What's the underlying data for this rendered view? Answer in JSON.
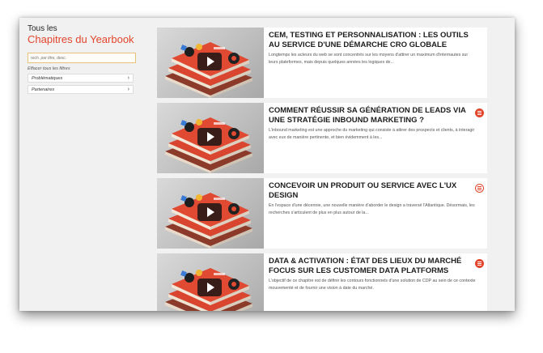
{
  "sidebar": {
    "title_top": "Tous les",
    "title_main": "Chapitres du Yearbook",
    "search_placeholder": "rech. par titre, desc.",
    "clear_filters": "Effacer tous les filtres",
    "filters": [
      {
        "label": "Problématiques"
      },
      {
        "label": "Partenaires"
      }
    ]
  },
  "cards": [
    {
      "title": "CEM, TESTING ET PERSONNALISATION : LES OUTILS AU SERVICE D'UNE DÉMARCHE CRO GLOBALE",
      "description": "Longtemps les acteurs du web se sont concentrés sur les moyens d'attirer un maximum d'internautes sur leurs plateformes, mais depuis quelques années les logiques de...",
      "icon": "none"
    },
    {
      "title": "COMMENT RÉUSSIR SA GÉNÉRATION DE LEADS VIA UNE STRATÉGIE INBOUND MARKETING ?",
      "description": "L'inbound marketing est une approche du marketing qui consiste à attirer des prospects et clients, à interagir avec eux de manière pertinente, et bien évidemment à les...",
      "icon": "filled"
    },
    {
      "title": "CONCEVOIR UN PRODUIT OU SERVICE AVEC L'UX DESIGN",
      "description": "En l'espace d'une décennie, une nouvelle manière d'aborder le design a traversé l'Atlantique. Désormais, les recherches s'articulent de plus en plus autour de la...",
      "icon": "outline"
    },
    {
      "title": "DATA & ACTIVATION : ÉTAT DES LIEUX DU MARCHÉ FOCUS SUR LES CUSTOMER DATA PLATFORMS",
      "description": "L'objectif de ce chapitre est de définir les contours fonctionnels d'une solution de CDP au sein de ce contexte mouvementé et de fournir une vision à date du marché.",
      "icon": "filled"
    }
  ],
  "colors": {
    "accent": "#e2452b",
    "background": "#f1f1f1",
    "card": "#ffffff"
  },
  "icons": {
    "play": "play-icon",
    "list": "list-icon",
    "chevron": "chevron-right-icon"
  }
}
